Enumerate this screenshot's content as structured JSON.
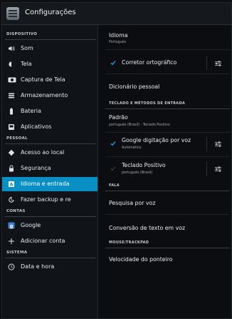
{
  "app": {
    "title": "Configurações",
    "icon": "settings-app-icon"
  },
  "sidebar": {
    "sections": [
      {
        "key": "dispositivo",
        "label": "DISPOSITIVO"
      },
      {
        "key": "pessoal",
        "label": "PESSOAL"
      },
      {
        "key": "contas",
        "label": "CONTAS"
      },
      {
        "key": "sistema",
        "label": "SISTEMA"
      }
    ],
    "items": [
      {
        "label": "Som",
        "icon": "speaker-icon"
      },
      {
        "label": "Tela",
        "icon": "brightness-icon"
      },
      {
        "label": "Captura de Tela",
        "icon": "screenshot-icon"
      },
      {
        "label": "Armazenamento",
        "icon": "storage-icon"
      },
      {
        "label": "Bateria",
        "icon": "battery-icon"
      },
      {
        "label": "Aplicativos",
        "icon": "apps-icon"
      },
      {
        "label": "Acesso ao local",
        "icon": "location-icon"
      },
      {
        "label": "Segurança",
        "icon": "lock-icon"
      },
      {
        "label": "Idioma e entrada",
        "icon": "keyboard-icon",
        "selected": true
      },
      {
        "label": "Fazer backup e re",
        "icon": "backup-icon"
      },
      {
        "label": "Google",
        "icon": "google-icon"
      },
      {
        "label": "Adicionar conta",
        "icon": "plus-icon"
      },
      {
        "label": "Data e hora",
        "icon": "clock-icon"
      }
    ]
  },
  "main": {
    "idioma": {
      "title": "Idioma",
      "value": "Português"
    },
    "corretor": {
      "label": "Corretor ortográfico",
      "checked": true
    },
    "dicionario": {
      "label": "Dicionário pessoal"
    },
    "section_teclado": "TECLADO E MÉTODOS DE ENTRADA",
    "padrao": {
      "title": "Padrão",
      "value": "português (Brasil) - Teclado Positivo"
    },
    "google_voz": {
      "title": "Google digitação por voz",
      "sub": "Automático",
      "checked": true
    },
    "teclado_positivo": {
      "title": "Teclado Positivo",
      "sub": "português (Brasil)",
      "checked": false
    },
    "section_fala": "FALA",
    "pesquisa_voz": {
      "label": "Pesquisa por voz"
    },
    "tts": {
      "label": "Conversão de texto em voz"
    },
    "section_mouse": "MOUSE/TRACKPAD",
    "ponteiro": {
      "label": "Velocidade do ponteiro"
    }
  },
  "colors": {
    "selected_bg": "#0a8fc4",
    "check_blue": "#1fa6e0",
    "background": "#0b0d10"
  }
}
